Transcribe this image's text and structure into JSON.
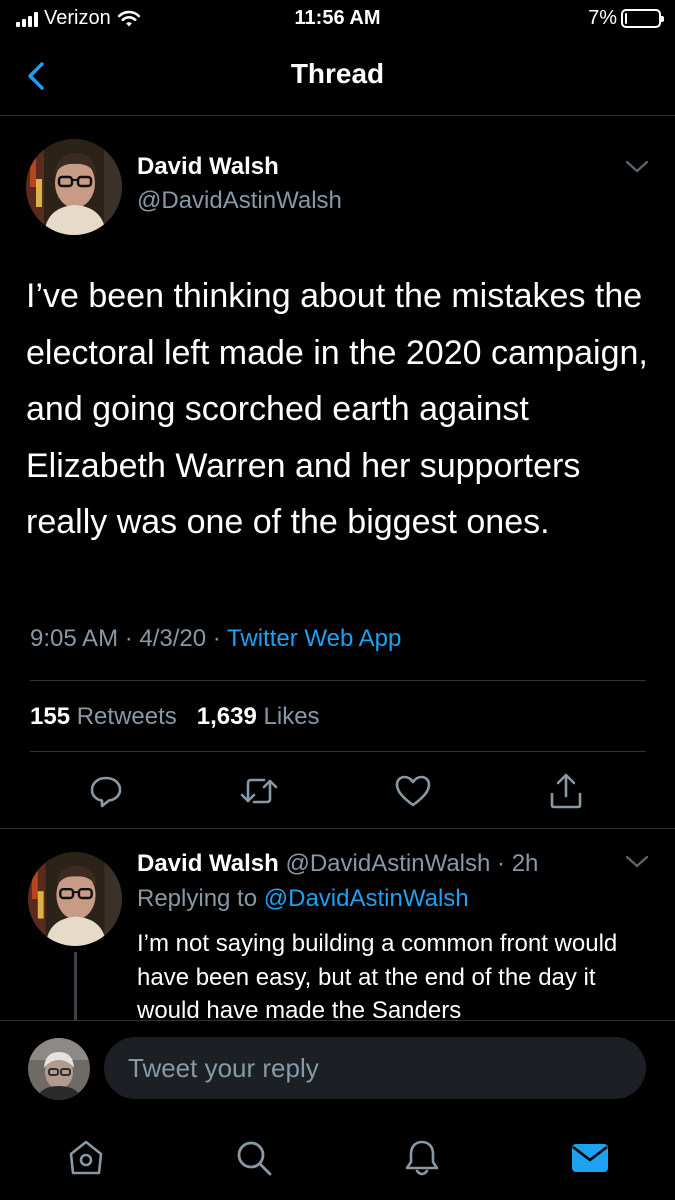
{
  "status_bar": {
    "carrier": "Verizon",
    "time": "11:56 AM",
    "battery_label": "7%",
    "battery_level": 0.07
  },
  "nav": {
    "title": "Thread"
  },
  "main_tweet": {
    "author_name": "David Walsh",
    "author_handle": "@DavidAstinWalsh",
    "text": "I’ve been thinking about the mistakes the electoral left made in the 2020 campaign, and going scorched earth against Elizabeth Warren and her supporters really was one of the biggest ones.",
    "time": "9:05 AM",
    "sep1": " · ",
    "date": "4/3/20",
    "sep2": " · ",
    "source": "Twitter Web App",
    "retweets_count": "155",
    "retweets_label": "Retweets",
    "likes_count": "1,639",
    "likes_label": "Likes"
  },
  "reply_tweet": {
    "author_name": "David Walsh",
    "author_handle": "@DavidAstinWalsh",
    "age": "2h",
    "replying_prefix": "Replying to",
    "replying_to": "@DavidAstinWalsh",
    "text": "I’m not saying building a common front would have been easy, but at the end of the day it would have made the Sanders"
  },
  "compose": {
    "placeholder": "Tweet your reply"
  },
  "colors": {
    "background": "#000000",
    "accent": "#1da1f2",
    "secondary_text": "#8899a6",
    "divider": "#2f3336"
  },
  "icons": {
    "back": "chevron-left-icon",
    "more": "chevron-down-icon",
    "reply": "comment-icon",
    "retweet": "retweet-icon",
    "like": "heart-icon",
    "share": "share-icon",
    "home": "home-icon",
    "search": "search-icon",
    "notifications": "bell-icon",
    "messages": "mail-icon"
  }
}
